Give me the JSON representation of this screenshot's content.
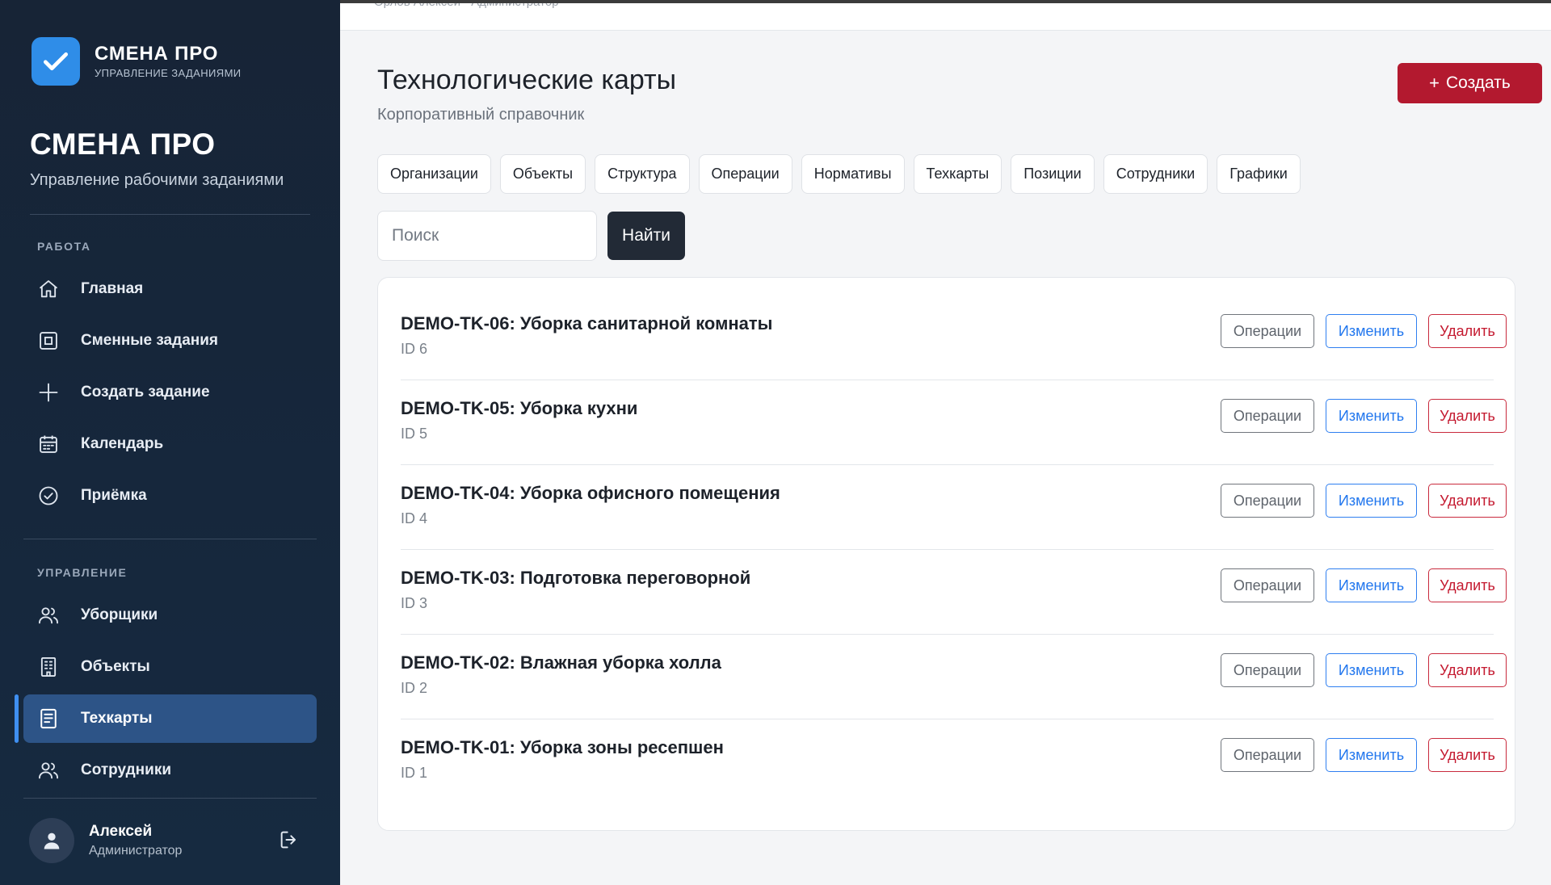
{
  "sidebar": {
    "logo_title": "СМЕНА ПРО",
    "logo_subtitle": "УПРАВЛЕНИЕ ЗАДАНИЯМИ",
    "brand_title": "СМЕНА ПРО",
    "brand_subtitle": "Управление рабочими заданиями",
    "section_work": "РАБОТА",
    "section_manage": "УПРАВЛЕНИЕ",
    "work_items": [
      {
        "label": "Главная",
        "icon": "home-icon"
      },
      {
        "label": "Сменные задания",
        "icon": "task-square-icon"
      },
      {
        "label": "Создать задание",
        "icon": "plus-icon"
      },
      {
        "label": "Календарь",
        "icon": "calendar-icon"
      },
      {
        "label": "Приёмка",
        "icon": "check-circle-icon"
      }
    ],
    "manage_items": [
      {
        "label": "Уборщики",
        "icon": "users-icon"
      },
      {
        "label": "Объекты",
        "icon": "building-icon"
      },
      {
        "label": "Техкарты",
        "icon": "document-icon",
        "active": true
      },
      {
        "label": "Сотрудники",
        "icon": "users-icon"
      }
    ],
    "user": {
      "name": "Алексей",
      "role": "Администратор"
    }
  },
  "topbar": {
    "text": "Орлов Алексей · Администратор"
  },
  "page": {
    "title": "Технологические карты",
    "subtitle": "Корпоративный справочник",
    "create_label": "Создать"
  },
  "tabs": [
    "Организации",
    "Объекты",
    "Структура",
    "Операции",
    "Нормативы",
    "Техкарты",
    "Позиции",
    "Сотрудники",
    "Графики"
  ],
  "search": {
    "placeholder": "Поиск",
    "value": "",
    "button_label": "Найти"
  },
  "rows": [
    {
      "title": "DEMO-TK-06: Уборка санитарной комнаты",
      "id": "ID 6"
    },
    {
      "title": "DEMO-TK-05: Уборка кухни",
      "id": "ID 5"
    },
    {
      "title": "DEMO-TK-04: Уборка офисного помещения",
      "id": "ID 4"
    },
    {
      "title": "DEMO-TK-03: Подготовка переговорной",
      "id": "ID 3"
    },
    {
      "title": "DEMO-TK-02: Влажная уборка холла",
      "id": "ID 2"
    },
    {
      "title": "DEMO-TK-01: Уборка зоны ресепшен",
      "id": "ID 1"
    }
  ],
  "row_actions": {
    "ops": "Операции",
    "edit": "Изменить",
    "delete": "Удалить"
  },
  "colors": {
    "sidebar_bg": "#172436",
    "active_nav": "#2d5487",
    "accent_blue": "#2f7ff0",
    "danger": "#b3192f",
    "dark_button": "#222a36"
  }
}
